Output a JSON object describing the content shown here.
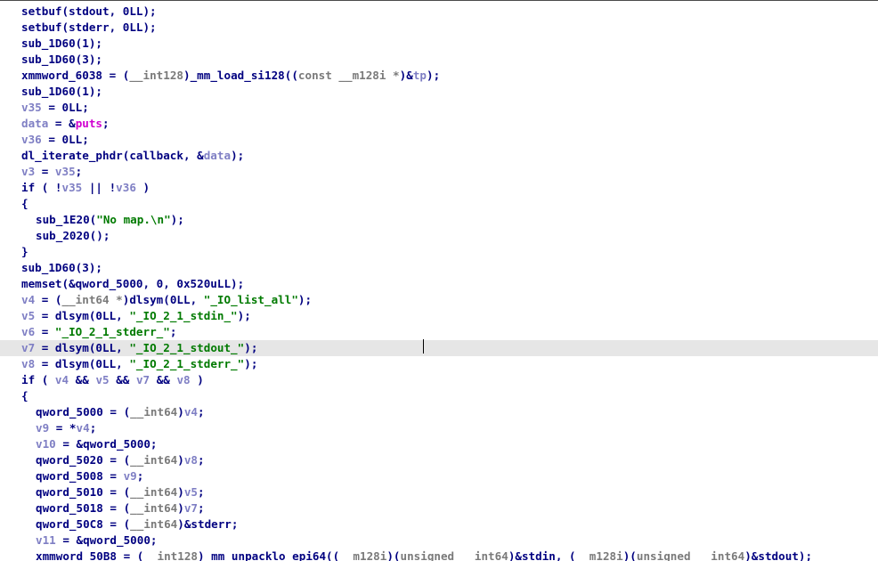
{
  "editor": {
    "highlighted_line_index": 21,
    "lines": [
      {
        "indent": 24,
        "tokens": [
          {
            "t": "setbuf(stdout, 0LL);",
            "c": "d"
          }
        ]
      },
      {
        "indent": 24,
        "tokens": [
          {
            "t": "setbuf(stderr, 0LL);",
            "c": "d"
          }
        ]
      },
      {
        "indent": 24,
        "tokens": [
          {
            "t": "sub_1D60(1);",
            "c": "d"
          }
        ]
      },
      {
        "indent": 24,
        "tokens": [
          {
            "t": "sub_1D60(3);",
            "c": "d"
          }
        ]
      },
      {
        "indent": 24,
        "tokens": [
          {
            "t": "xmmword_6038 = (",
            "c": "d"
          },
          {
            "t": "__int128",
            "c": "k"
          },
          {
            "t": ")_mm_load_si128((",
            "c": "d"
          },
          {
            "t": "const __m128i *",
            "c": "k"
          },
          {
            "t": ")&",
            "c": "d"
          },
          {
            "t": "tp",
            "c": "v"
          },
          {
            "t": ");",
            "c": "d"
          }
        ]
      },
      {
        "indent": 24,
        "tokens": [
          {
            "t": "sub_1D60(1);",
            "c": "d"
          }
        ]
      },
      {
        "indent": 24,
        "tokens": [
          {
            "t": "v35",
            "c": "v"
          },
          {
            "t": " = 0LL;",
            "c": "d"
          }
        ]
      },
      {
        "indent": 24,
        "tokens": [
          {
            "t": "data",
            "c": "v"
          },
          {
            "t": " = &",
            "c": "d"
          },
          {
            "t": "puts",
            "c": "f"
          },
          {
            "t": ";",
            "c": "d"
          }
        ]
      },
      {
        "indent": 24,
        "tokens": [
          {
            "t": "v36",
            "c": "v"
          },
          {
            "t": " = 0LL;",
            "c": "d"
          }
        ]
      },
      {
        "indent": 24,
        "tokens": [
          {
            "t": "dl_iterate_phdr(callback, &",
            "c": "d"
          },
          {
            "t": "data",
            "c": "v"
          },
          {
            "t": ");",
            "c": "d"
          }
        ]
      },
      {
        "indent": 24,
        "tokens": [
          {
            "t": "v3",
            "c": "v"
          },
          {
            "t": " = ",
            "c": "d"
          },
          {
            "t": "v35",
            "c": "v"
          },
          {
            "t": ";",
            "c": "d"
          }
        ]
      },
      {
        "indent": 24,
        "tokens": [
          {
            "t": "if ( !",
            "c": "d"
          },
          {
            "t": "v35",
            "c": "v"
          },
          {
            "t": " || !",
            "c": "d"
          },
          {
            "t": "v36",
            "c": "v"
          },
          {
            "t": " )",
            "c": "d"
          }
        ]
      },
      {
        "indent": 24,
        "tokens": [
          {
            "t": "{",
            "c": "d"
          }
        ]
      },
      {
        "indent": 40,
        "tokens": [
          {
            "t": "sub_1E20(",
            "c": "d"
          },
          {
            "t": "\"No map.\\n\"",
            "c": "s"
          },
          {
            "t": ");",
            "c": "d"
          }
        ]
      },
      {
        "indent": 40,
        "tokens": [
          {
            "t": "sub_2020();",
            "c": "d"
          }
        ]
      },
      {
        "indent": 24,
        "tokens": [
          {
            "t": "}",
            "c": "d"
          }
        ]
      },
      {
        "indent": 24,
        "tokens": [
          {
            "t": "sub_1D60(3);",
            "c": "d"
          }
        ]
      },
      {
        "indent": 24,
        "tokens": [
          {
            "t": "memset(&qword_5000, 0, 0x520uLL);",
            "c": "d"
          }
        ]
      },
      {
        "indent": 24,
        "tokens": [
          {
            "t": "v4",
            "c": "v"
          },
          {
            "t": " = (",
            "c": "d"
          },
          {
            "t": "__int64 *",
            "c": "k"
          },
          {
            "t": ")dlsym(0LL, ",
            "c": "d"
          },
          {
            "t": "\"_IO_list_all\"",
            "c": "s"
          },
          {
            "t": ");",
            "c": "d"
          }
        ]
      },
      {
        "indent": 24,
        "tokens": [
          {
            "t": "v5",
            "c": "v"
          },
          {
            "t": " = dlsym(0LL, ",
            "c": "d"
          },
          {
            "t": "\"_IO_2_1_stdin_\"",
            "c": "s"
          },
          {
            "t": ");",
            "c": "d"
          }
        ]
      },
      {
        "indent": 24,
        "tokens": [
          {
            "t": "v6",
            "c": "v"
          },
          {
            "t": " = ",
            "c": "d"
          },
          {
            "t": "\"_IO_2_1_stderr_\"",
            "c": "s"
          },
          {
            "t": ";",
            "c": "d"
          }
        ]
      },
      {
        "indent": 24,
        "tokens": [
          {
            "t": "v7",
            "c": "v"
          },
          {
            "t": " = dlsym(0LL, ",
            "c": "d"
          },
          {
            "t": "\"_IO_2_1_stdout_\"",
            "c": "s"
          },
          {
            "t": ");",
            "c": "d"
          }
        ]
      },
      {
        "indent": 24,
        "tokens": [
          {
            "t": "v8",
            "c": "v"
          },
          {
            "t": " = dlsym(0LL, ",
            "c": "d"
          },
          {
            "t": "\"_IO_2_1_stderr_\"",
            "c": "s"
          },
          {
            "t": ");",
            "c": "d"
          }
        ]
      },
      {
        "indent": 24,
        "tokens": [
          {
            "t": "if ( ",
            "c": "d"
          },
          {
            "t": "v4",
            "c": "v"
          },
          {
            "t": " && ",
            "c": "d"
          },
          {
            "t": "v5",
            "c": "v"
          },
          {
            "t": " && ",
            "c": "d"
          },
          {
            "t": "v7",
            "c": "v"
          },
          {
            "t": " && ",
            "c": "d"
          },
          {
            "t": "v8",
            "c": "v"
          },
          {
            "t": " )",
            "c": "d"
          }
        ]
      },
      {
        "indent": 24,
        "tokens": [
          {
            "t": "{",
            "c": "d"
          }
        ]
      },
      {
        "indent": 40,
        "tokens": [
          {
            "t": "qword_5000 = (",
            "c": "d"
          },
          {
            "t": "__int64",
            "c": "k"
          },
          {
            "t": ")",
            "c": "d"
          },
          {
            "t": "v4",
            "c": "v"
          },
          {
            "t": ";",
            "c": "d"
          }
        ]
      },
      {
        "indent": 40,
        "tokens": [
          {
            "t": "v9",
            "c": "v"
          },
          {
            "t": " = *",
            "c": "d"
          },
          {
            "t": "v4",
            "c": "v"
          },
          {
            "t": ";",
            "c": "d"
          }
        ]
      },
      {
        "indent": 40,
        "tokens": [
          {
            "t": "v10",
            "c": "v"
          },
          {
            "t": " = &qword_5000;",
            "c": "d"
          }
        ]
      },
      {
        "indent": 40,
        "tokens": [
          {
            "t": "qword_5020 = (",
            "c": "d"
          },
          {
            "t": "__int64",
            "c": "k"
          },
          {
            "t": ")",
            "c": "d"
          },
          {
            "t": "v8",
            "c": "v"
          },
          {
            "t": ";",
            "c": "d"
          }
        ]
      },
      {
        "indent": 40,
        "tokens": [
          {
            "t": "qword_5008 = ",
            "c": "d"
          },
          {
            "t": "v9",
            "c": "v"
          },
          {
            "t": ";",
            "c": "d"
          }
        ]
      },
      {
        "indent": 40,
        "tokens": [
          {
            "t": "qword_5010 = (",
            "c": "d"
          },
          {
            "t": "__int64",
            "c": "k"
          },
          {
            "t": ")",
            "c": "d"
          },
          {
            "t": "v5",
            "c": "v"
          },
          {
            "t": ";",
            "c": "d"
          }
        ]
      },
      {
        "indent": 40,
        "tokens": [
          {
            "t": "qword_5018 = (",
            "c": "d"
          },
          {
            "t": "__int64",
            "c": "k"
          },
          {
            "t": ")",
            "c": "d"
          },
          {
            "t": "v7",
            "c": "v"
          },
          {
            "t": ";",
            "c": "d"
          }
        ]
      },
      {
        "indent": 40,
        "tokens": [
          {
            "t": "qword_50C8 = (",
            "c": "d"
          },
          {
            "t": "__int64",
            "c": "k"
          },
          {
            "t": ")&stderr;",
            "c": "d"
          }
        ]
      },
      {
        "indent": 40,
        "tokens": [
          {
            "t": "v11",
            "c": "v"
          },
          {
            "t": " = &qword_5000;",
            "c": "d"
          }
        ]
      },
      {
        "indent": 40,
        "tokens": [
          {
            "t": "xmmword_50B8 = (",
            "c": "d"
          },
          {
            "t": "__int128",
            "c": "k"
          },
          {
            "t": ")_mm_unpacklo_epi64((",
            "c": "d"
          },
          {
            "t": "__m128i",
            "c": "k"
          },
          {
            "t": ")(",
            "c": "d"
          },
          {
            "t": "unsigned __int64",
            "c": "k"
          },
          {
            "t": ")&stdin, (",
            "c": "d"
          },
          {
            "t": "__m128i",
            "c": "k"
          },
          {
            "t": ")(",
            "c": "d"
          },
          {
            "t": "unsigned __int64",
            "c": "k"
          },
          {
            "t": ")&stdout);",
            "c": "d"
          }
        ]
      }
    ]
  }
}
